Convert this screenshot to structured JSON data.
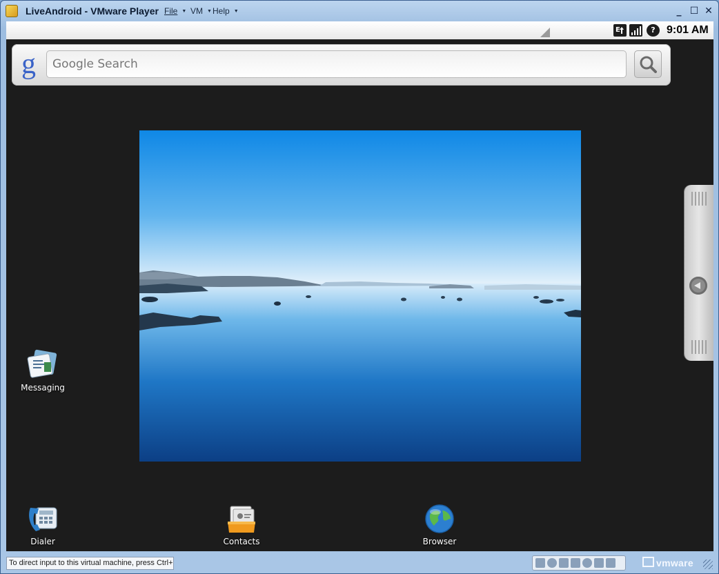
{
  "window": {
    "title": "LiveAndroid - VMware Player",
    "menus": [
      {
        "label": "File"
      },
      {
        "label": "VM"
      },
      {
        "label": "Help"
      }
    ],
    "controls": {
      "minimize": "_",
      "maximize": "☐",
      "close": "✕"
    }
  },
  "android": {
    "status_bar": {
      "time": "9:01 AM",
      "icons": [
        "data-transfer-icon",
        "signal-strength-icon",
        "battery-unknown-icon"
      ],
      "battery_label": "?"
    },
    "search_widget": {
      "logo": "g",
      "placeholder": "Google Search"
    },
    "shortcuts": [
      {
        "label": "Messaging",
        "icon": "messaging-icon"
      },
      {
        "label": "Dialer",
        "icon": "dialer-icon"
      },
      {
        "label": "Contacts",
        "icon": "contacts-icon"
      },
      {
        "label": "Browser",
        "icon": "browser-icon"
      }
    ],
    "wallpaper": "lake-landscape",
    "drawer_handle": "app-drawer-handle"
  },
  "vmware_status": {
    "tip": "To direct input to this virtual machine, press Ctrl+G.",
    "brand": "vmware"
  },
  "colors": {
    "android_background": "#1c1c1c",
    "title_gradient_top": "#bcd5ef",
    "google_blue": "#3a63c8"
  }
}
